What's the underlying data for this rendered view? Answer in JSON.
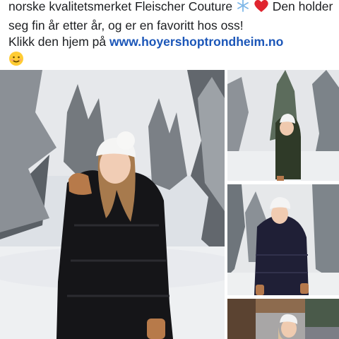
{
  "post": {
    "line1": "norske kvalitetsmerket Fleischer Couture",
    "line2_part1": "Den",
    "line2_part2": "holder seg fin år etter år, og er en favoritt hos oss!",
    "line3_prefix": "Klikk den hjem på",
    "link": "www.hoyershoptrondheim.no",
    "emojis": [
      "snowflake-emoji",
      "red-heart-emoji",
      "smiling-face-emoji"
    ]
  },
  "photos": [
    {
      "id": "main",
      "alt": "woman-black-long-puffer-coat"
    },
    {
      "id": "side1",
      "alt": "woman-dark-green-puffer-coat"
    },
    {
      "id": "side2",
      "alt": "woman-navy-puffer-coat"
    },
    {
      "id": "side3",
      "alt": "woman-in-town"
    }
  ],
  "colors": {
    "link": "#1b56b8",
    "text": "#1c1e21"
  }
}
